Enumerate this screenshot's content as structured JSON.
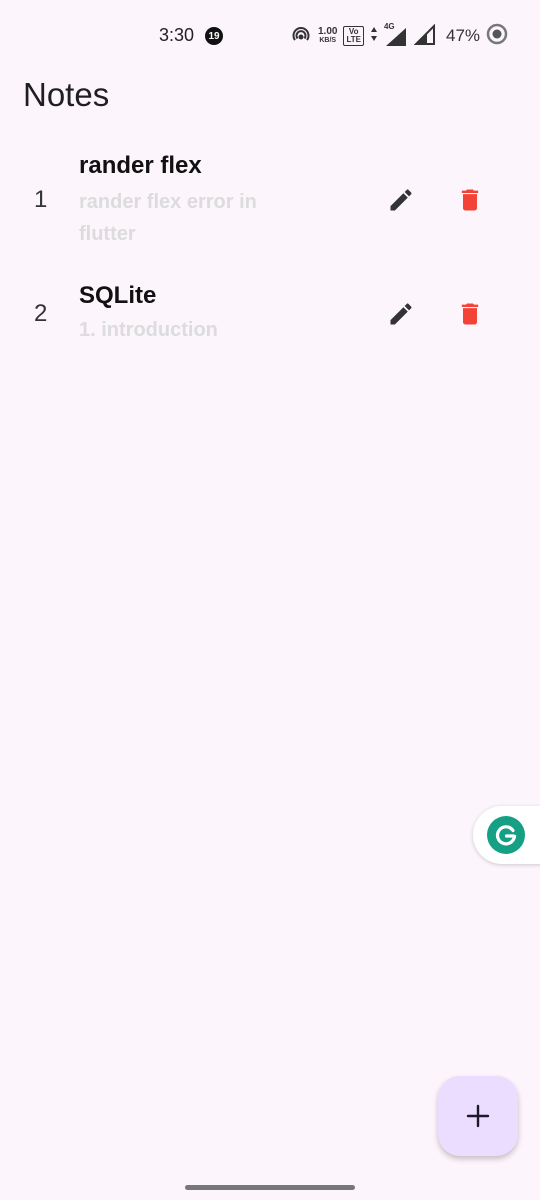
{
  "status_bar": {
    "time": "3:30",
    "notification_count": "19",
    "speed_value": "1.00",
    "speed_unit": "KB/S",
    "volte_top": "Vo",
    "volte_bottom": "LTE",
    "network": "4G",
    "battery": "47%"
  },
  "header": {
    "title": "Notes"
  },
  "notes": [
    {
      "index": "1",
      "title": "rander flex",
      "description": "rander flex error in flutter"
    },
    {
      "index": "2",
      "title": "SQLite",
      "description": "1. introduction"
    }
  ],
  "colors": {
    "background": "#fcf5fc",
    "edit_icon": "#333333",
    "delete_icon": "#f44336",
    "fab_background": "#eaddff",
    "grammarly": "#15a085"
  },
  "icons": {
    "edit": "pencil-icon",
    "delete": "trash-icon",
    "add": "plus-icon",
    "grammarly": "grammarly-icon"
  }
}
